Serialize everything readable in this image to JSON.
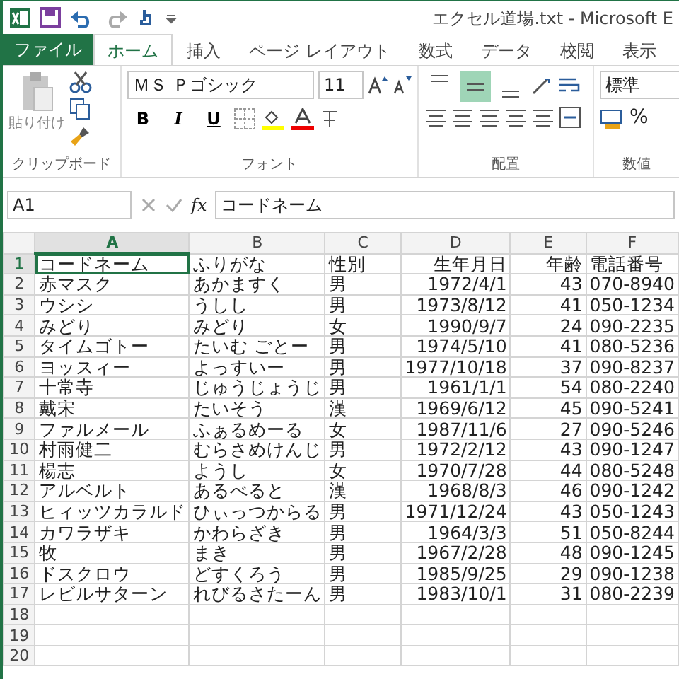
{
  "title_bar": {
    "title": "エクセル道場.txt - Microsoft E"
  },
  "tabs": [
    {
      "label": "ファイル",
      "kind": "file",
      "selected": false
    },
    {
      "label": "ホーム",
      "kind": "tab",
      "selected": true
    },
    {
      "label": "挿入",
      "kind": "tab",
      "selected": false
    },
    {
      "label": "ページ レイアウト",
      "kind": "tab",
      "selected": false
    },
    {
      "label": "数式",
      "kind": "tab",
      "selected": false
    },
    {
      "label": "データ",
      "kind": "tab",
      "selected": false
    },
    {
      "label": "校閲",
      "kind": "tab",
      "selected": false
    },
    {
      "label": "表示",
      "kind": "tab",
      "selected": false
    }
  ],
  "ribbon": {
    "clipboard": {
      "paste_label": "貼り付け",
      "label": "クリップボード"
    },
    "font": {
      "font_name": "ＭＳ Ｐゴシック",
      "font_size": "11",
      "bold": "B",
      "italic": "I",
      "underline": "U",
      "label": "フォント"
    },
    "alignment": {
      "vertical_align": [
        {
          "selected": false
        },
        {
          "selected": true
        },
        {
          "selected": false
        }
      ],
      "label": "配置"
    },
    "number": {
      "format": "標準",
      "percent": "%",
      "label": "数値"
    }
  },
  "formula_bar": {
    "name_box": "A1",
    "fx": "fx",
    "content": "コードネーム"
  },
  "columns": [
    {
      "label": "A",
      "kind": "text",
      "selected": true
    },
    {
      "label": "B",
      "kind": "text",
      "selected": false
    },
    {
      "label": "C",
      "kind": "text",
      "selected": false
    },
    {
      "label": "D",
      "kind": "number",
      "selected": false
    },
    {
      "label": "E",
      "kind": "number",
      "selected": false
    },
    {
      "label": "F",
      "kind": "text",
      "selected": false
    }
  ],
  "rows": [
    {
      "number": "1",
      "active": true,
      "cells": [
        "コードネーム",
        "ふりがな",
        "性別",
        "生年月日",
        "年齢",
        "電話番号"
      ]
    },
    {
      "number": "2",
      "active": false,
      "cells": [
        "赤マスク",
        "あかますく",
        "男",
        "1972/4/1",
        "43",
        "070-8940"
      ]
    },
    {
      "number": "3",
      "active": false,
      "cells": [
        "ウシシ",
        "うしし",
        "男",
        "1973/8/12",
        "41",
        "050-1234"
      ]
    },
    {
      "number": "4",
      "active": false,
      "cells": [
        "みどり",
        "みどり",
        "女",
        "1990/9/7",
        "24",
        "090-2235"
      ]
    },
    {
      "number": "5",
      "active": false,
      "cells": [
        "タイムゴトー",
        "たいむ ごとー",
        "男",
        "1974/5/10",
        "41",
        "080-5236"
      ]
    },
    {
      "number": "6",
      "active": false,
      "cells": [
        "ヨッスィー",
        "よっすいー",
        "男",
        "1977/10/18",
        "37",
        "090-8237"
      ]
    },
    {
      "number": "7",
      "active": false,
      "cells": [
        "十常寺",
        "じゅうじょうじ",
        "男",
        "1961/1/1",
        "54",
        "080-2240"
      ]
    },
    {
      "number": "8",
      "active": false,
      "cells": [
        "戴宋",
        "たいそう",
        "漢",
        "1969/6/12",
        "45",
        "090-5241"
      ]
    },
    {
      "number": "9",
      "active": false,
      "cells": [
        "ファルメール",
        "ふぁるめーる",
        "女",
        "1987/11/6",
        "27",
        "090-5246"
      ]
    },
    {
      "number": "10",
      "active": false,
      "cells": [
        "村雨健二",
        "むらさめけんじ",
        "男",
        "1972/2/12",
        "43",
        "090-1247"
      ]
    },
    {
      "number": "11",
      "active": false,
      "cells": [
        "楊志",
        "ようし",
        "女",
        "1970/7/28",
        "44",
        "080-5248"
      ]
    },
    {
      "number": "12",
      "active": false,
      "cells": [
        "アルベルト",
        "あるべると",
        "漢",
        "1968/8/3",
        "46",
        "090-1242"
      ]
    },
    {
      "number": "13",
      "active": false,
      "cells": [
        "ヒィッツカラルド",
        "ひぃっつからる",
        "男",
        "1971/12/24",
        "43",
        "050-1243"
      ]
    },
    {
      "number": "14",
      "active": false,
      "cells": [
        "カワラザキ",
        "かわらざき",
        "男",
        "1964/3/3",
        "51",
        "050-8244"
      ]
    },
    {
      "number": "15",
      "active": false,
      "cells": [
        "牧",
        "まき",
        "男",
        "1967/2/28",
        "48",
        "090-1245"
      ]
    },
    {
      "number": "16",
      "active": false,
      "cells": [
        "ドスクロウ",
        "どすくろう",
        "男",
        "1985/9/25",
        "29",
        "090-1238"
      ]
    },
    {
      "number": "17",
      "active": false,
      "cells": [
        "レビルサターン",
        "れびるさたーん",
        "男",
        "1983/10/1",
        "31",
        "080-2239"
      ]
    },
    {
      "number": "18",
      "active": false
    },
    {
      "number": "19",
      "active": false
    },
    {
      "number": "20",
      "active": false
    }
  ]
}
